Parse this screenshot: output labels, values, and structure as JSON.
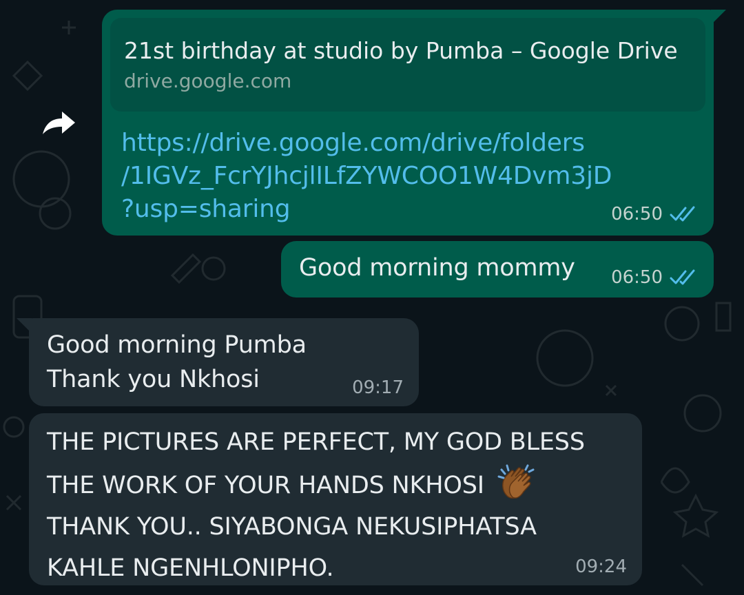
{
  "theme": {
    "background": "#0b141a",
    "outgoing_bubble": "#005c4b",
    "incoming_bubble": "#202c33",
    "link_color": "#53bdeb",
    "read_tick_color": "#53bdeb"
  },
  "forward_action": {
    "icon": "forward-arrow-icon"
  },
  "messages": [
    {
      "direction": "outgoing",
      "link_preview": {
        "title": "21st birthday at studio by Pumba – Google Drive",
        "domain": "drive.google.com"
      },
      "text": "https://drive.google.com/drive/folders\n/1IGVz_FcrYJhcjlILfZYWCOO1W4Dvm3jD\n?usp=sharing",
      "time": "06:50",
      "status": "read",
      "status_icon": "double-check-icon"
    },
    {
      "direction": "outgoing",
      "text": "Good morning mommy",
      "time": "06:50",
      "status": "read",
      "status_icon": "double-check-icon"
    },
    {
      "direction": "incoming",
      "text": "Good morning Pumba\nThank you Nkhosi",
      "time": "09:17"
    },
    {
      "direction": "incoming",
      "text_before_emoji": "THE PICTURES ARE PERFECT, MY GOD BLESS\nTHE WORK OF YOUR HANDS NKHOSI ",
      "emoji": "clapping-hands-icon",
      "text_after_emoji": "\nTHANK YOU.. SIYABONGA NEKUSIPHATSA\nKAHLE NGENHLONIPHO.",
      "time": "09:24"
    }
  ]
}
